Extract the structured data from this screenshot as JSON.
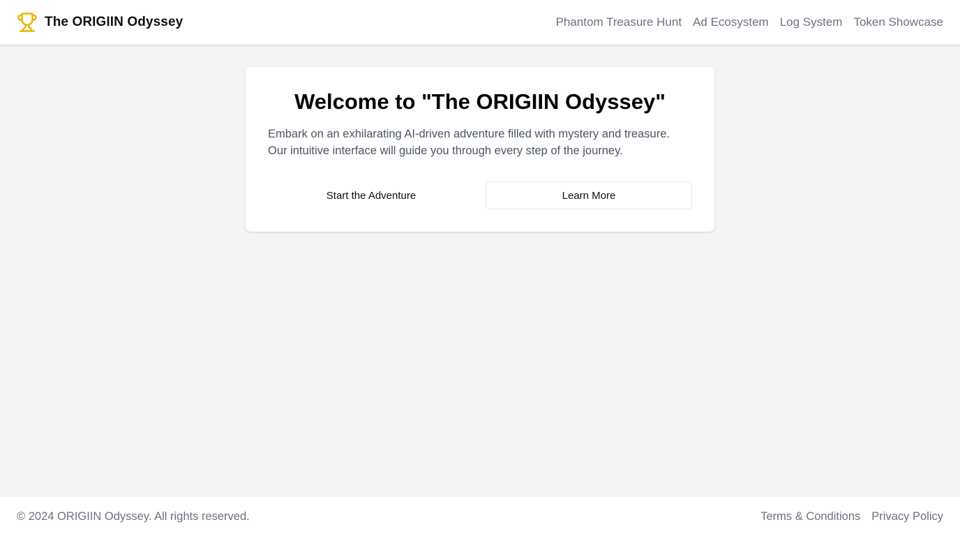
{
  "header": {
    "brand_title": "The ORIGIIN Odyssey",
    "brand_icon": "trophy-icon",
    "nav": [
      {
        "label": "Phantom Treasure Hunt"
      },
      {
        "label": "Ad Ecosystem"
      },
      {
        "label": "Log System"
      },
      {
        "label": "Token Showcase"
      }
    ]
  },
  "main": {
    "title": "Welcome to \"The ORIGIIN Odyssey\"",
    "description": "Embark on an exhilarating AI-driven adventure filled with mystery and treasure. Our intuitive interface will guide you through every step of the journey.",
    "primary_button": "Start the Adventure",
    "secondary_button": "Learn More"
  },
  "footer": {
    "copyright": "© 2024 ORIGIIN Odyssey. All rights reserved.",
    "links": [
      {
        "label": "Terms & Conditions"
      },
      {
        "label": "Privacy Policy"
      }
    ]
  },
  "colors": {
    "accent_icon": "#eab308",
    "background": "#f3f4f6",
    "surface": "#ffffff",
    "muted_text": "#6b7280"
  }
}
